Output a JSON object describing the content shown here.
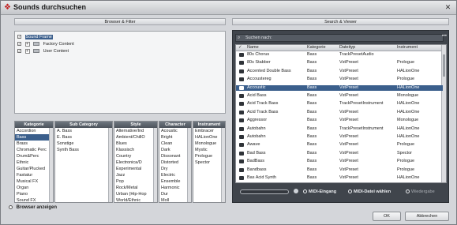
{
  "window": {
    "title": "Sounds durchsuchen"
  },
  "left_pane": {
    "header": "Browser & Filter"
  },
  "right_pane": {
    "header": "Search & Viewer"
  },
  "tree": [
    {
      "label": "Sound Frame",
      "level": 0,
      "selected": true
    },
    {
      "label": "Factory Content",
      "level": 1
    },
    {
      "label": "User Content",
      "level": 1
    }
  ],
  "filters": {
    "columns": [
      {
        "header": "Kategorie",
        "items": [
          "Accordion",
          "Bass",
          "Brass",
          "Chromatic Perc",
          "Drum&Perc",
          "Ethnic",
          "Guitar/Plucked",
          "Fastatur",
          "Musical FX",
          "Organ",
          "Piano",
          "Sound FX"
        ],
        "selected": "Bass"
      },
      {
        "header": "Sub Category",
        "items": [
          "A. Bass",
          "E. Bass",
          "Sonstige",
          "Synth Bass"
        ]
      },
      {
        "header": "Style",
        "items": [
          "Alternative/Ind",
          "Ambient/ChillO",
          "Blues",
          "Klassisch",
          "Country",
          "Electronica/D",
          "Experimental",
          "Jazz",
          "Pop",
          "Rock/Metal",
          "Urban (Hip-Hop",
          "World/Ethnic"
        ]
      },
      {
        "header": "Character",
        "items": [
          "Acoustic",
          "Bright",
          "Clean",
          "Dark",
          "Dissonant",
          "Distorted",
          "Dry",
          "Electric",
          "Ensemble",
          "Harmonic",
          "Dur",
          "Moll"
        ]
      },
      {
        "header": "Instrument",
        "items": [
          "Embracer",
          "HALionOne",
          "Monologue",
          "Mystic",
          "Prologue",
          "Spector"
        ]
      }
    ]
  },
  "browser_toggle": "Browser anzeigen",
  "search": {
    "placeholder": "Suchen nach:"
  },
  "results": {
    "columns": [
      "Name",
      "Kategorie",
      "Dateityp",
      "Instrument"
    ],
    "rows": [
      [
        "80s Chorus",
        "Bass",
        "TrackPresetAudio",
        ""
      ],
      [
        "80s Stabber",
        "Bass",
        "VstPreset",
        "Prologue"
      ],
      [
        "Accented Double Bass",
        "Bass",
        "VstPreset",
        "HALionOne"
      ],
      [
        "Accoustereg",
        "Bass",
        "VstPreset",
        "Prologue"
      ],
      [
        "Accoustic",
        "Bass",
        "VstPreset",
        "HALionOne"
      ],
      [
        "Acid Bass",
        "Bass",
        "VstPreset",
        "Monologue"
      ],
      [
        "Acid Track Bass",
        "Bass",
        "TrackPresetInstrument",
        "HALionOne"
      ],
      [
        "Acid Track Bass",
        "Bass",
        "VstPreset",
        "HALionOne"
      ],
      [
        "Aggressor",
        "Bass",
        "VstPreset",
        "Monologue"
      ],
      [
        "Autobahn",
        "Bass",
        "TrackPresetInstrument",
        "HALionOne"
      ],
      [
        "Autobahn",
        "Bass",
        "VstPreset",
        "HALionOne"
      ],
      [
        "Awave",
        "Bass",
        "VstPreset",
        "Prologue"
      ],
      [
        "Bad Bass",
        "Bass",
        "VstPreset",
        "Spector"
      ],
      [
        "BadBass",
        "Bass",
        "VstPreset",
        "Prologue"
      ],
      [
        "Bandbass",
        "Bass",
        "VstPreset",
        "Prologue"
      ],
      [
        "Bas Acid Synth",
        "Bass",
        "VstPreset",
        "HALionOne"
      ]
    ],
    "selected_index": 4
  },
  "transport": {
    "midi_input": "MIDI-Eingang",
    "midi_file": "MIDI-Datei wählen",
    "playback": "Wiedergabe"
  },
  "buttons": {
    "ok": "OK",
    "cancel": "Abbrechen"
  }
}
